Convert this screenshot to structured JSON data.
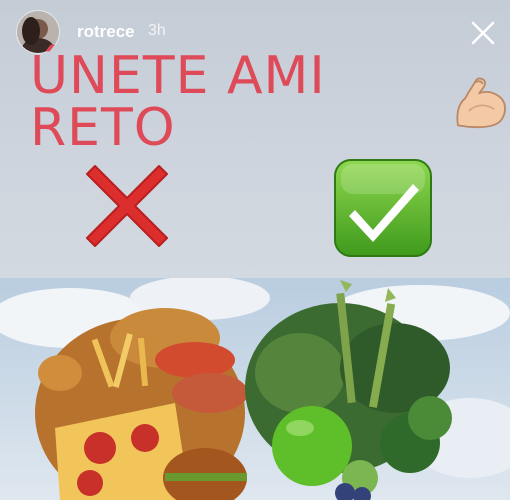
{
  "story": {
    "username": "rotrece",
    "timestamp": "3h"
  },
  "headline": {
    "text": "ÚNETE AMI RETO",
    "emoji": "flexed-biceps-icon"
  },
  "icons": {
    "cross": "cross-mark-icon",
    "check": "check-mark-button-icon",
    "close": "close-icon"
  },
  "colors": {
    "headline": "#de4a58",
    "cross": "#dd2e2e",
    "check": "#5db32e",
    "panel": "#c9cfd8"
  }
}
